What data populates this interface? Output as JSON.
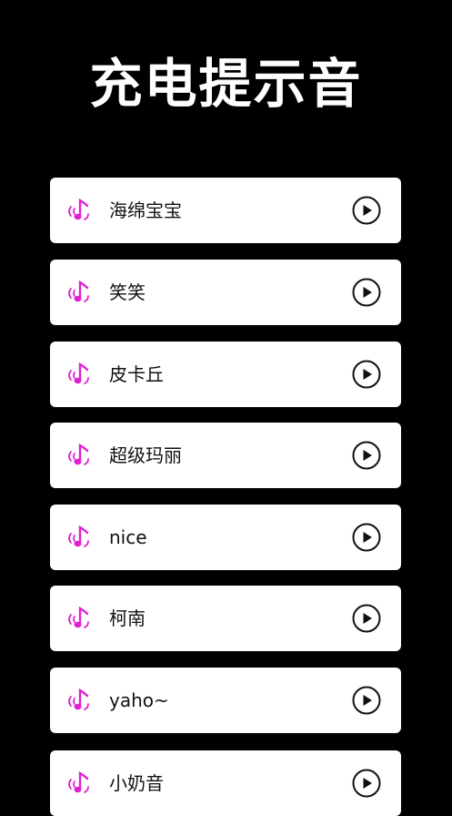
{
  "header": {
    "title": "充电提示音"
  },
  "colors": {
    "background": "#000000",
    "card": "#ffffff",
    "accent": "#e020d0",
    "text": "#111111"
  },
  "icons": {
    "note": "music-note-sound-icon",
    "play": "play-circle-icon"
  },
  "items": [
    {
      "label": "海绵宝宝"
    },
    {
      "label": "笑笑"
    },
    {
      "label": "皮卡丘"
    },
    {
      "label": "超级玛丽"
    },
    {
      "label": "nice"
    },
    {
      "label": "柯南"
    },
    {
      "label": "yaho~"
    },
    {
      "label": "小奶音"
    }
  ]
}
